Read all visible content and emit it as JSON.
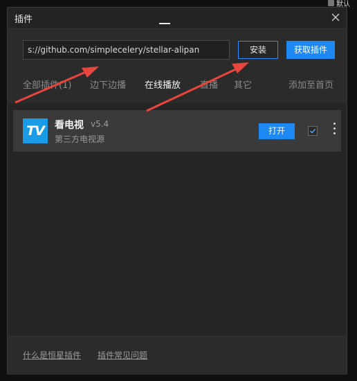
{
  "background": {
    "corner_text": "默认"
  },
  "dialog": {
    "title": "插件",
    "close_icon": "close-icon"
  },
  "install_bar": {
    "url_value": "s://github.com/simplecelery/stellar-alipan",
    "install_label": "安装",
    "get_plugins_label": "获取插件"
  },
  "tabs": [
    {
      "label": "全部插件(1)",
      "active": false
    },
    {
      "label": "边下边播",
      "active": false
    },
    {
      "label": "在线播放",
      "active": true
    },
    {
      "label": "直播",
      "active": false
    },
    {
      "label": "其它",
      "active": false
    }
  ],
  "add_to_home_label": "添加至首页",
  "plugins": [
    {
      "logo_text": "TV",
      "name": "看电视",
      "version": "v5.4",
      "description": "第三方电视源",
      "open_label": "打开",
      "checked": true
    }
  ],
  "footer": {
    "link1": "什么是恒星插件",
    "link2": "插件常见问题"
  },
  "colors": {
    "accent": "#1e88f3",
    "annotation_arrow": "#e8453c",
    "dialog_bg": "#2b2b2c"
  }
}
